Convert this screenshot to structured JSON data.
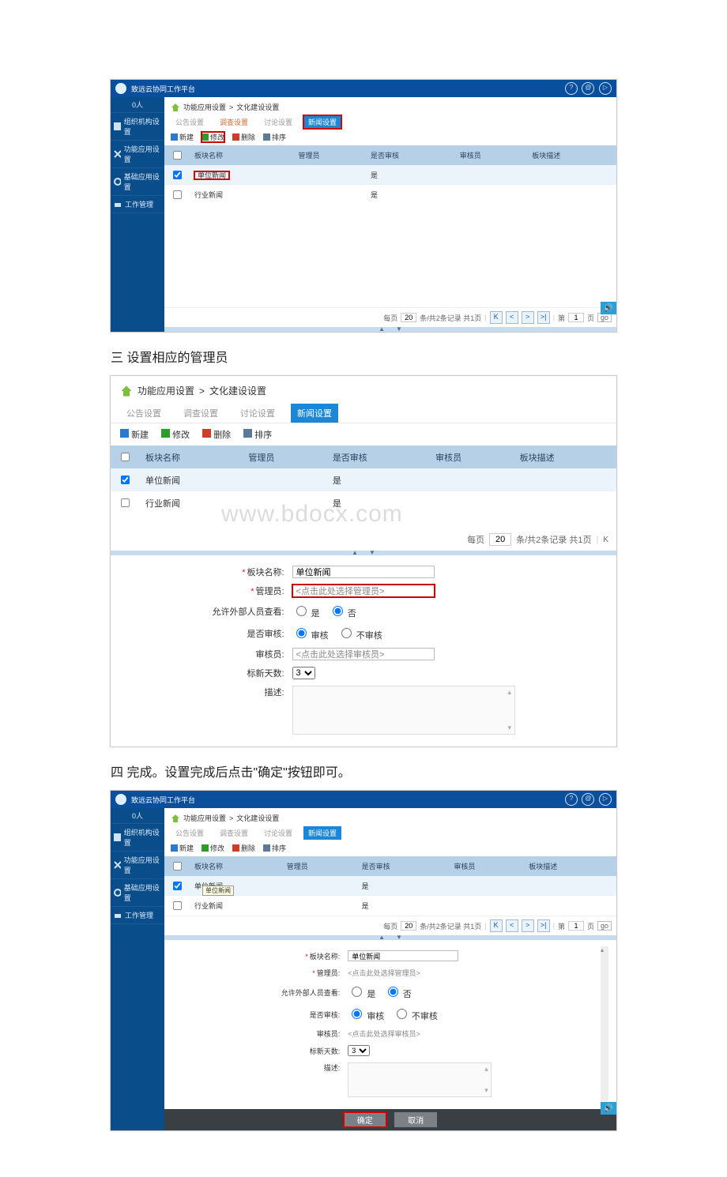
{
  "titlebar": {
    "title": "致远云协同工作平台"
  },
  "top_icons": {
    "a": "?",
    "b": "@",
    "c": "▷"
  },
  "sidebar": {
    "count": "0人",
    "items": [
      {
        "label": "组织机构设置",
        "icon": "org"
      },
      {
        "label": "功能应用设置",
        "icon": "func"
      },
      {
        "label": "基础应用设置",
        "icon": "base"
      },
      {
        "label": "工作管理",
        "icon": "work"
      }
    ]
  },
  "breadcrumb": {
    "a": "功能应用设置",
    "b": "文化建设设置",
    "sep": " > "
  },
  "tabs": {
    "a": "公告设置",
    "b": "调查设置",
    "c": "讨论设置",
    "d": "新闻设置"
  },
  "toolbar": {
    "new": "新建",
    "edit": "修改",
    "del": "删除",
    "sort": "排序"
  },
  "columns": {
    "chk": "",
    "name": "板块名称",
    "mgr": "管理员",
    "audit": "是否审核",
    "auditor": "审核员",
    "desc": "板块描述"
  },
  "rows": [
    {
      "name": "单位新闻",
      "mgr": "",
      "audit": "是",
      "auditor": "",
      "desc": ""
    },
    {
      "name": "行业新闻",
      "mgr": "",
      "audit": "是",
      "auditor": "",
      "desc": ""
    }
  ],
  "row0_tooltip": "单位新闻",
  "pager": {
    "each": "每页",
    "size": "20",
    "info": "条/共2条记录  共1页",
    "page_prefix": "第",
    "page": "1",
    "page_suffix": "页",
    "go": "go"
  },
  "step3": "三 设置相应的管理员",
  "watermark": "www.bdocx.com",
  "form": {
    "name_lbl": "板块名称:",
    "name_val": "单位新闻",
    "mgr_lbl": "管理员:",
    "mgr_val": "<点击此处选择管理员>",
    "out_lbl": "允许外部人员查看:",
    "out_yes": "是",
    "out_no": "否",
    "audit_lbl": "是否审核:",
    "audit_yes": "审核",
    "audit_no": "不审核",
    "auditor_lbl": "审核员:",
    "auditor_val": "<点击此处选择审核员>",
    "days_lbl": "标新天数:",
    "days_val": "3",
    "desc_lbl": "描述:"
  },
  "step4": "四 完成。设置完成后点击\"确定\"按钮即可。",
  "dlg": {
    "ok": "确定",
    "cancel": "取消"
  }
}
